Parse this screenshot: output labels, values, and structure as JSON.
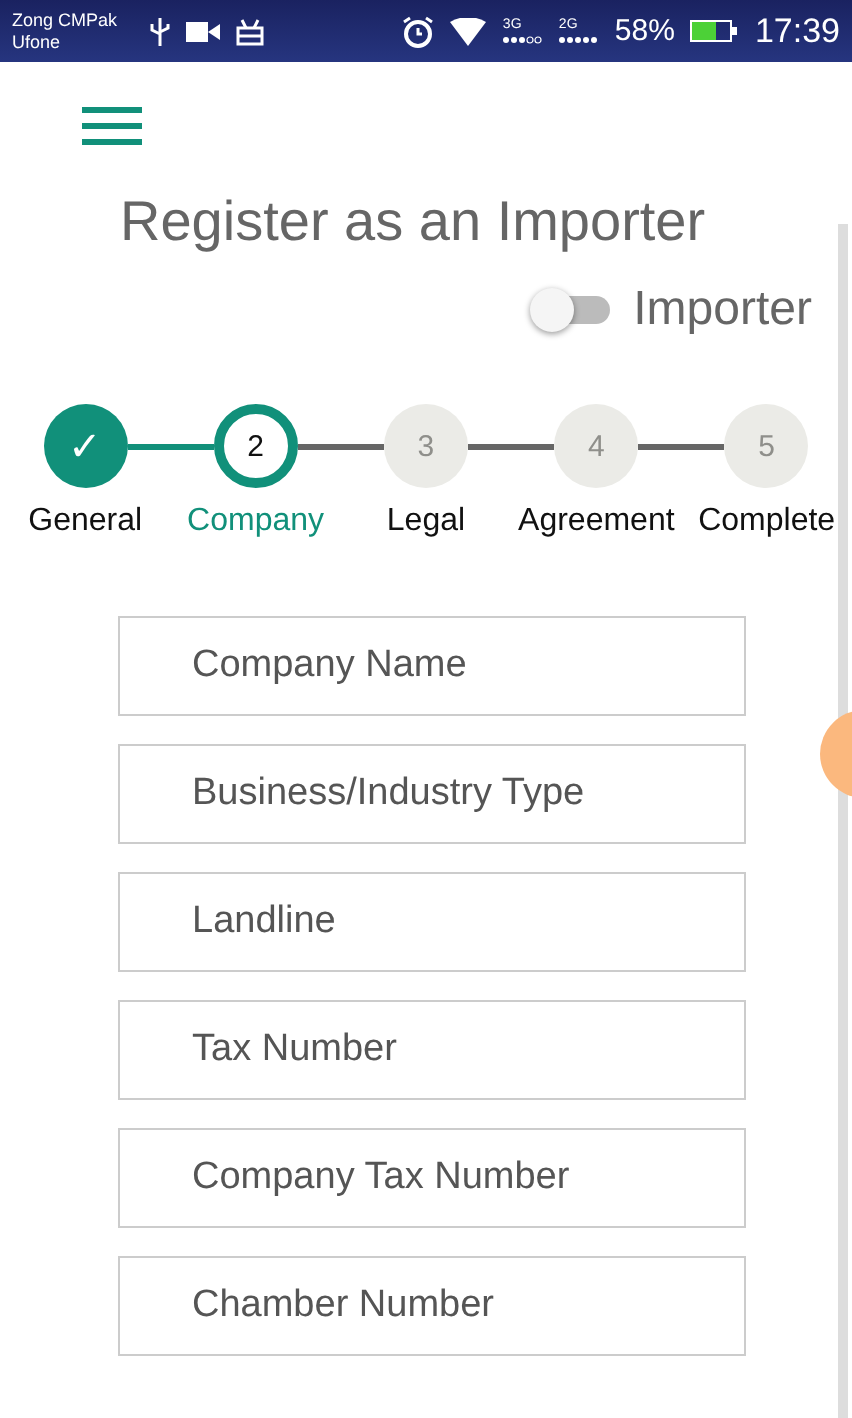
{
  "status_bar": {
    "carrier_1": "Zong CMPak",
    "carrier_2": "Ufone",
    "network_1": "3G",
    "network_2": "2G",
    "battery": "58%",
    "time": "17:39"
  },
  "title": "Register as an Importer",
  "role_toggle": {
    "label": "Importer",
    "on": false
  },
  "steps": [
    {
      "marker": "✓",
      "label": "General",
      "completed": true,
      "selected": false
    },
    {
      "marker": "2",
      "label": "Company",
      "completed": false,
      "selected": true
    },
    {
      "marker": "3",
      "label": "Legal",
      "completed": false,
      "selected": false
    },
    {
      "marker": "4",
      "label": "Agreement",
      "completed": false,
      "selected": false
    },
    {
      "marker": "5",
      "label": "Complete",
      "completed": false,
      "selected": false
    }
  ],
  "fields": [
    {
      "placeholder": "Company Name"
    },
    {
      "placeholder": "Business/Industry Type"
    },
    {
      "placeholder": "Landline"
    },
    {
      "placeholder": "Tax Number"
    },
    {
      "placeholder": "Company Tax Number"
    },
    {
      "placeholder": "Chamber Number"
    }
  ]
}
